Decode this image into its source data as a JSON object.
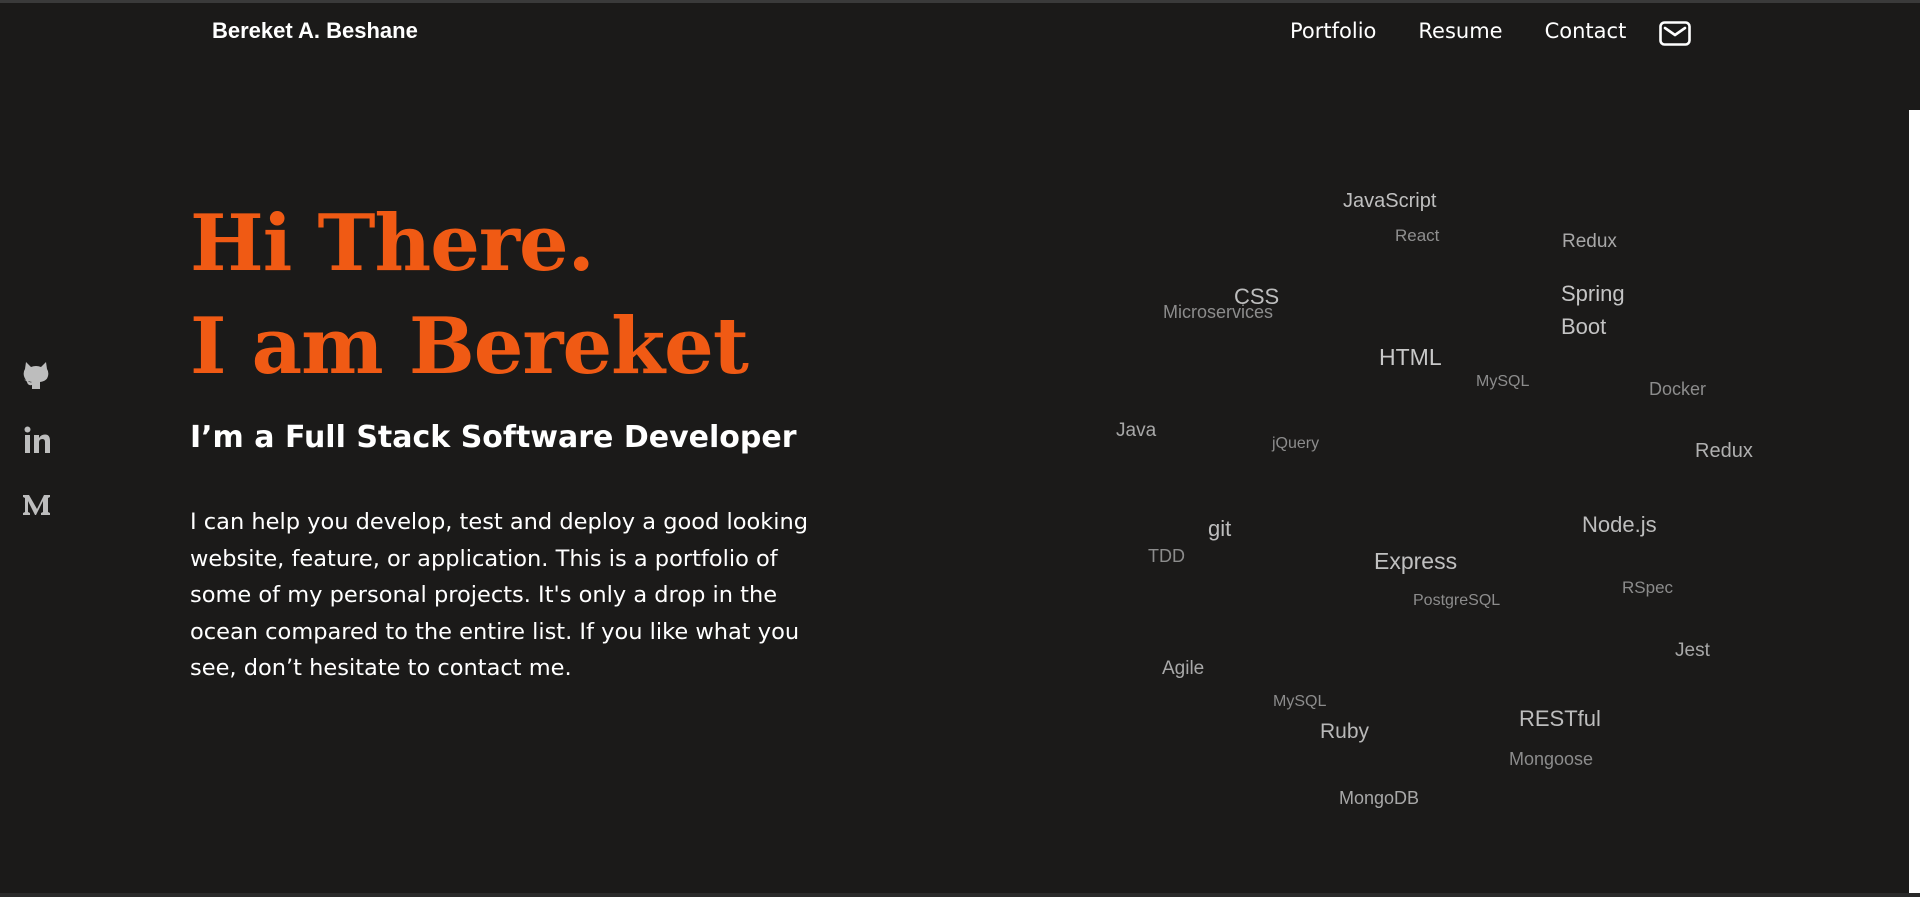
{
  "header": {
    "brand": "Bereket A. Beshane",
    "nav": [
      "Portfolio",
      "Resume",
      "Contact"
    ]
  },
  "icons": {
    "mail": "envelope-icon",
    "social": [
      "github-icon",
      "linkedin-icon",
      "medium-icon"
    ]
  },
  "hero": {
    "line1": "Hi There.",
    "line2": "I am Bereket",
    "subtitle": "I’m a Full Stack Software Developer",
    "intro": "I can help you develop, test and deploy a good looking website, feature, or application. This is a portfolio of some of my personal projects. It's only a drop in the ocean compared to the entire list. If you like what you see, don’t hesitate to contact me."
  },
  "skills": [
    "JavaScript",
    "React",
    "Redux",
    "CSS",
    "Microservices",
    "Spring",
    "Boot",
    "HTML",
    "MySQL",
    "Docker",
    "Java",
    "jQuery",
    "Redux",
    "git",
    "Node.js",
    "TDD",
    "Express",
    "RSpec",
    "PostgreSQL",
    "Jest",
    "Agile",
    "MySQL",
    "RESTful",
    "Ruby",
    "Mongoose",
    "MongoDB"
  ],
  "colors": {
    "background": "#1b1a19",
    "accent": "#f05a14",
    "text": "#ffffff"
  }
}
